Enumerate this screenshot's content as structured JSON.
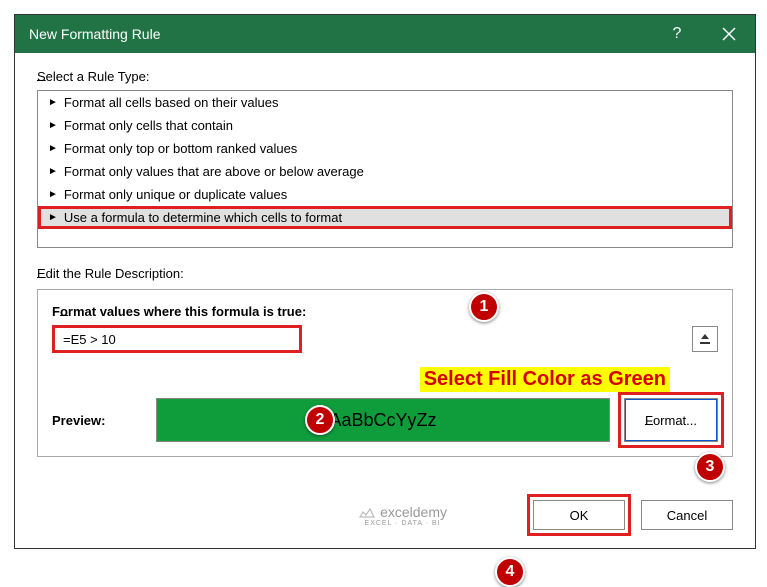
{
  "titlebar": {
    "title": "New Formatting Rule"
  },
  "sections": {
    "select_label": "Select a Rule Type:",
    "edit_label": "Edit the Rule Description:"
  },
  "rule_types": [
    "Format all cells based on their values",
    "Format only cells that contain",
    "Format only top or bottom ranked values",
    "Format only values that are above or below average",
    "Format only unique or duplicate values",
    "Use a formula to determine which cells to format"
  ],
  "selected_rule_index": 5,
  "formula": {
    "label": "Format values where this formula is true:",
    "value": "=E5 > 10"
  },
  "annotation": "Select Fill Color as Green",
  "preview": {
    "label": "Preview:",
    "sample": "AaBbCcYyZz",
    "format_btn": "Format..."
  },
  "buttons": {
    "ok": "OK",
    "cancel": "Cancel"
  },
  "watermark": {
    "brand": "exceldemy",
    "sub": "EXCEL · DATA · BI"
  },
  "steps": {
    "s1": "1",
    "s2": "2",
    "s3": "3",
    "s4": "4"
  }
}
